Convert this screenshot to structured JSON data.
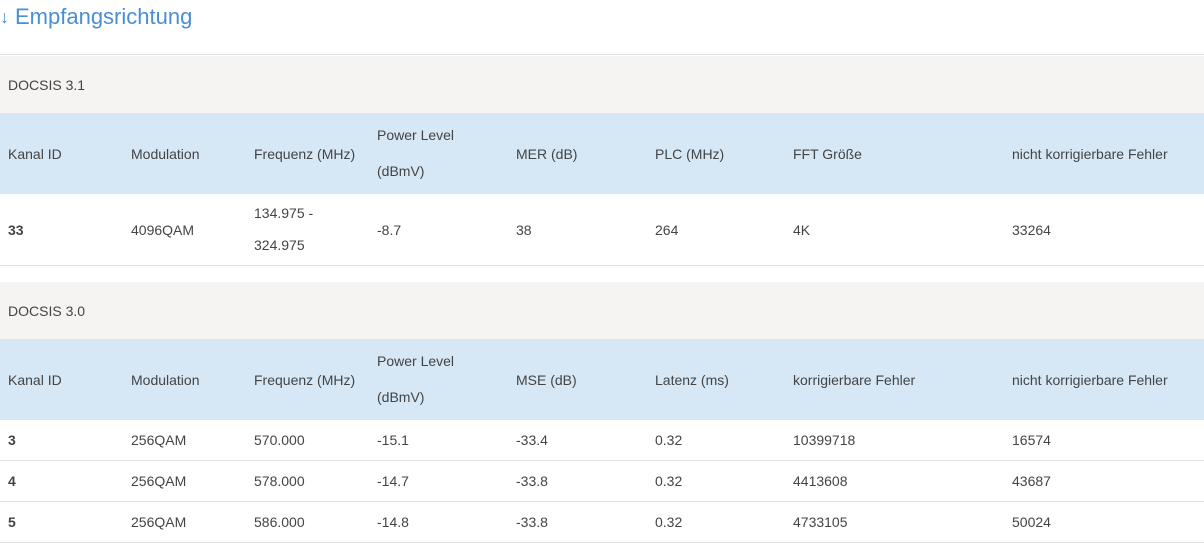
{
  "title": {
    "icon": "arrow-down-icon",
    "text": "Empfangsrichtung"
  },
  "docsis31": {
    "heading": "DOCSIS 3.1",
    "columns": [
      "Kanal ID",
      "Modulation",
      "Frequenz (MHz)",
      "Power Level (dBmV)",
      "MER (dB)",
      "PLC (MHz)",
      "FFT Größe",
      "nicht korrigierbare Fehler"
    ],
    "power_level_line1": "Power Level",
    "power_level_line2": "(dBmV)",
    "rows": [
      {
        "kanal": "33",
        "modulation": "4096QAM",
        "freq_line1": "134.975 -",
        "freq_line2": "324.975",
        "power": "-8.7",
        "mer": "38",
        "plc": "264",
        "fft": "4K",
        "nicht_korr": "33264"
      }
    ]
  },
  "docsis30": {
    "heading": "DOCSIS 3.0",
    "columns": [
      "Kanal ID",
      "Modulation",
      "Frequenz (MHz)",
      "Power Level (dBmV)",
      "MSE (dB)",
      "Latenz (ms)",
      "korrigierbare Fehler",
      "nicht korrigierbare Fehler"
    ],
    "power_level_line1": "Power Level",
    "power_level_line2": "(dBmV)",
    "rows": [
      {
        "kanal": "3",
        "modulation": "256QAM",
        "freq": "570.000",
        "power": "-15.1",
        "mse": "-33.4",
        "latenz": "0.32",
        "korr": "10399718",
        "nicht_korr": "16574"
      },
      {
        "kanal": "4",
        "modulation": "256QAM",
        "freq": "578.000",
        "power": "-14.7",
        "mse": "-33.8",
        "latenz": "0.32",
        "korr": "4413608",
        "nicht_korr": "43687"
      },
      {
        "kanal": "5",
        "modulation": "256QAM",
        "freq": "586.000",
        "power": "-14.8",
        "mse": "-33.8",
        "latenz": "0.32",
        "korr": "4733105",
        "nicht_korr": "50024"
      }
    ]
  },
  "colors": {
    "accent": "#4a8fd3",
    "header_bg": "#d6e7f6",
    "section_bg": "#f5f4f2",
    "text": "#444444"
  }
}
